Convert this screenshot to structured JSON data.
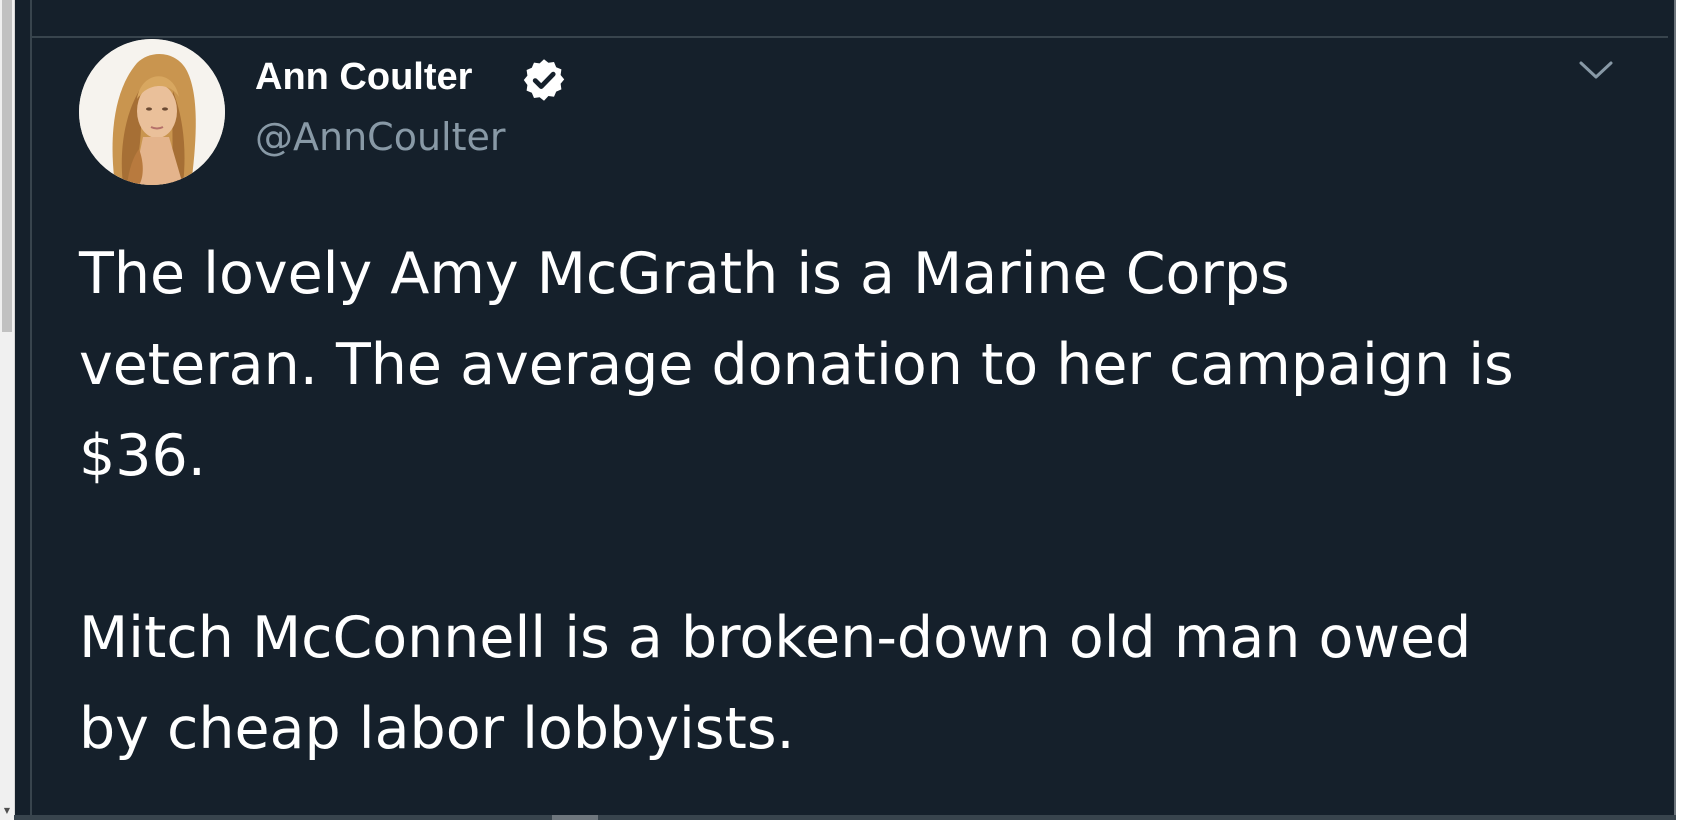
{
  "tweet": {
    "display_name": "Ann Coulter",
    "handle": "@AnnCoulter",
    "verified": true,
    "text_lines": [
      "The lovely Amy McGrath is a Marine Corps",
      "veteran.  The average donation to her campaign is",
      "$36.",
      "Mitch McConnell is a broken-down old man owed",
      "by cheap labor lobbyists."
    ]
  },
  "icons": {
    "verified": "verified-badge-icon",
    "menu": "chevron-down-icon",
    "scroll_down": "scroll-down-arrow-icon"
  },
  "colors": {
    "background": "#15202b",
    "text": "#ffffff",
    "secondary_text": "#8899a6",
    "divider": "#38444d"
  }
}
